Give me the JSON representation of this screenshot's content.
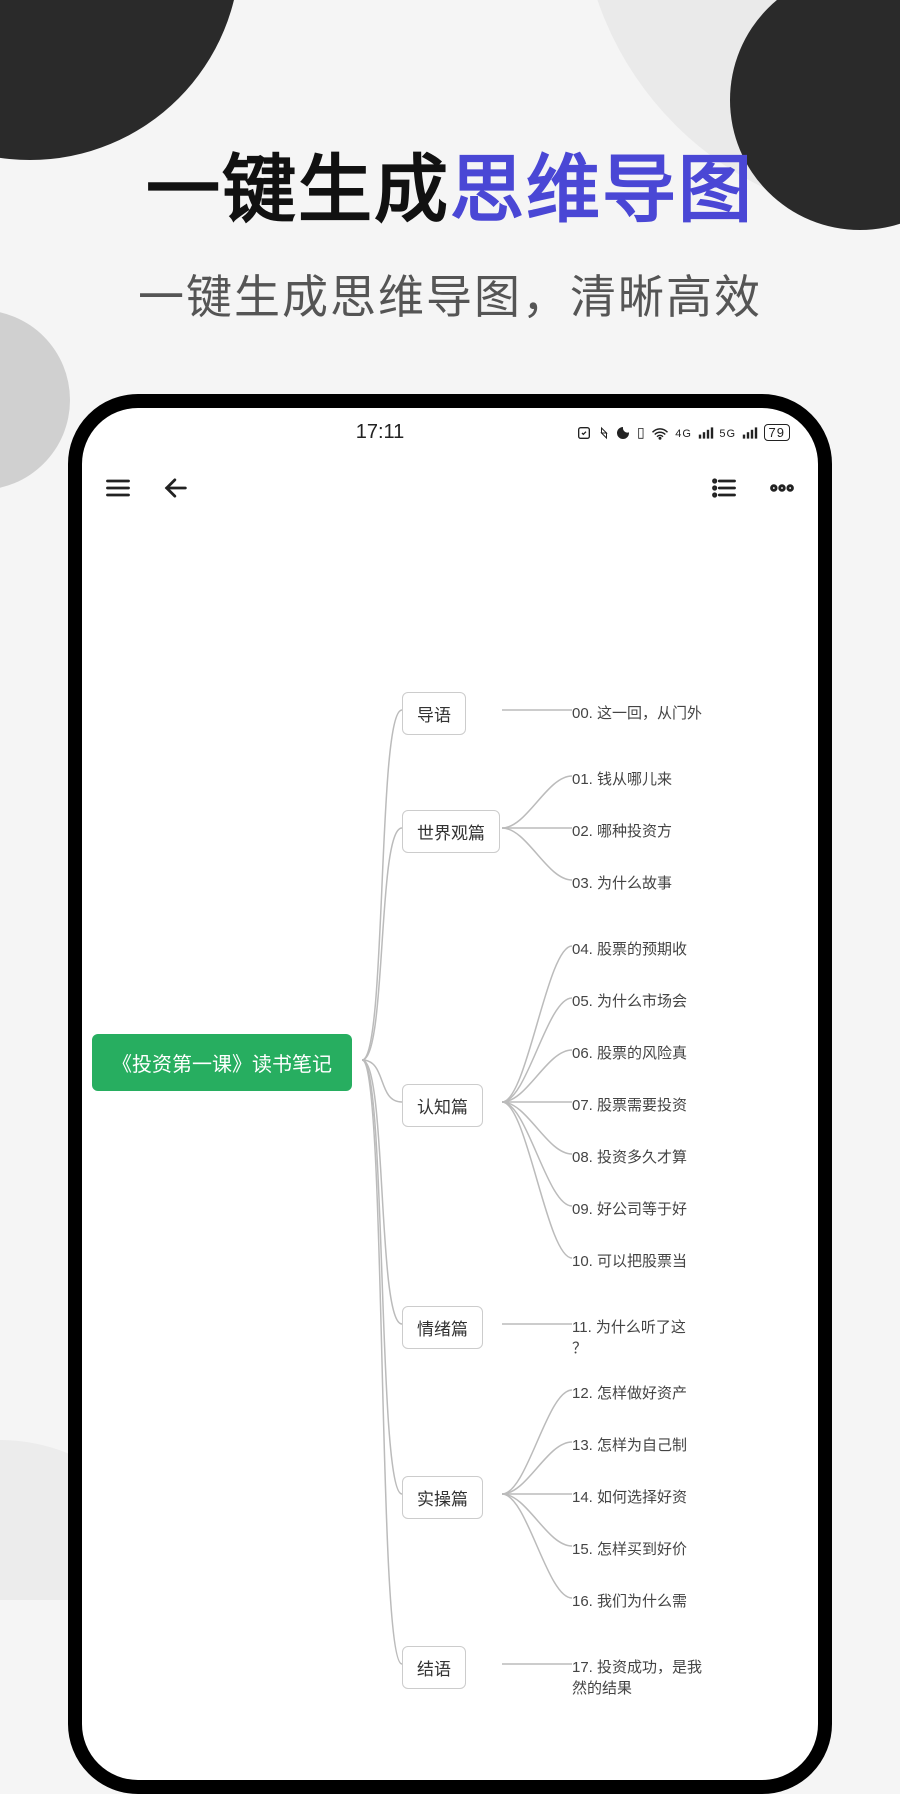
{
  "promo": {
    "title_part1": "一键生成",
    "title_part2": "思维导图",
    "subtitle": "一键生成思维导图，清晰高效"
  },
  "statusbar": {
    "time": "17:11",
    "indicators": "ℕ �ııı 4G ⁵ᴳ 79",
    "battery": "79"
  },
  "mindmap": {
    "root": "《投资第一课》读书笔记",
    "sections": [
      {
        "label": "导语",
        "leaves": [
          "00. 这一回，从门外"
        ]
      },
      {
        "label": "世界观篇",
        "leaves": [
          "01. 钱从哪儿来",
          "02. 哪种投资方",
          "03. 为什么故事"
        ]
      },
      {
        "label": "认知篇",
        "leaves": [
          "04. 股票的预期收",
          "05. 为什么市场会",
          "06. 股票的风险真",
          "07. 股票需要投资",
          "08. 投资多久才算",
          "09. 好公司等于好",
          "10. 可以把股票当"
        ]
      },
      {
        "label": "情绪篇",
        "leaves": [
          "11. 为什么听了这\n？"
        ]
      },
      {
        "label": "实操篇",
        "leaves": [
          "12. 怎样做好资产",
          "13. 怎样为自己制",
          "14. 如何选择好资",
          "15. 怎样买到好价",
          "16. 我们为什么需"
        ]
      },
      {
        "label": "结语",
        "leaves": [
          "17. 投资成功，是我\n然的结果"
        ]
      }
    ]
  }
}
